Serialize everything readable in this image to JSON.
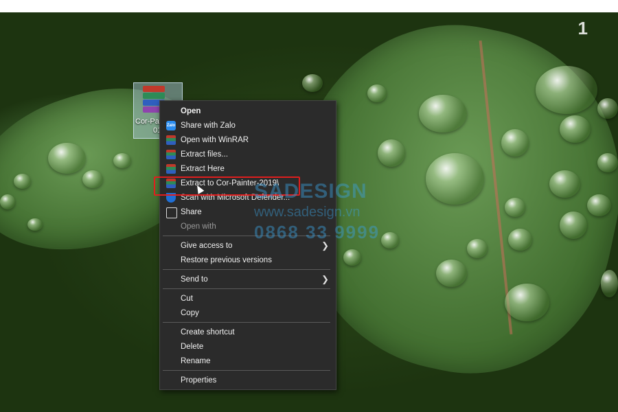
{
  "page_badge": "1",
  "file": {
    "name": "Cor-Pai",
    "name_line2": "01"
  },
  "menu": {
    "items": [
      {
        "label": "Open",
        "bold": true
      },
      {
        "label": "Share with Zalo",
        "icon": "zalo-icon"
      },
      {
        "label": "Open with WinRAR",
        "icon": "winrar-icon"
      },
      {
        "label": "Extract files...",
        "icon": "winrar-icon"
      },
      {
        "label": "Extract Here",
        "icon": "winrar-icon"
      },
      {
        "label": "Extract to Cor-Painter-2019\\",
        "icon": "winrar-icon",
        "highlighted": true
      },
      {
        "label": "Scan with Microsoft Defender...",
        "icon": "defender-icon"
      },
      {
        "label": "Share",
        "icon": "share-icon"
      },
      {
        "label": "Open with",
        "dim": true
      },
      {
        "label": "Give access to",
        "submenu": true
      },
      {
        "label": "Restore previous versions"
      },
      {
        "label": "Send to",
        "submenu": true
      },
      {
        "label": "Cut"
      },
      {
        "label": "Copy"
      },
      {
        "label": "Create shortcut"
      },
      {
        "label": "Delete"
      },
      {
        "label": "Rename"
      },
      {
        "label": "Properties"
      }
    ]
  },
  "watermark": {
    "brand": "SADESIGN",
    "url": "www.sadesign.vn",
    "phone": "0868 33 9999"
  },
  "colors": {
    "highlight_border": "#e01e1e",
    "menu_bg": "#2b2b2b",
    "watermark": "#3ca0dc"
  }
}
